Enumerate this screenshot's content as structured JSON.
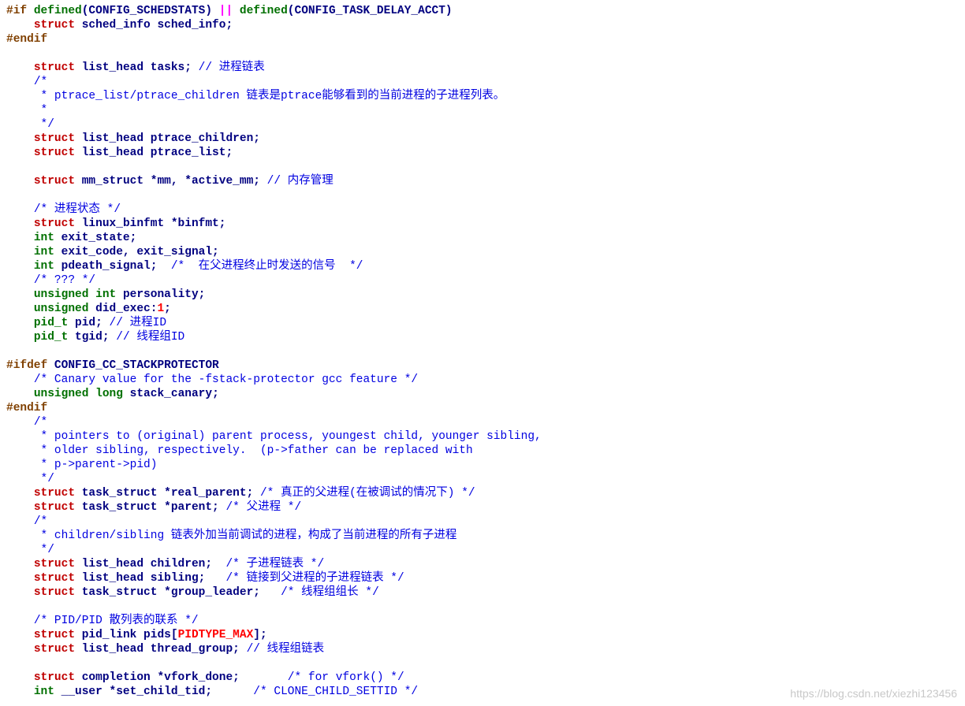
{
  "lines": [
    [
      [
        "pp",
        "#if"
      ],
      [
        "tx",
        " "
      ],
      [
        "ty",
        "defined"
      ],
      [
        "tx",
        "(CONFIG_SCHEDSTATS) "
      ],
      [
        "op",
        "||"
      ],
      [
        "tx",
        " "
      ],
      [
        "ty",
        "defined"
      ],
      [
        "tx",
        "(CONFIG_TASK_DELAY_ACCT)"
      ]
    ],
    [
      [
        "tx",
        "    "
      ],
      [
        "kw",
        "struct"
      ],
      [
        "tx",
        " sched_info sched_info;"
      ]
    ],
    [
      [
        "pp",
        "#endif"
      ]
    ],
    [],
    [
      [
        "tx",
        "    "
      ],
      [
        "kw",
        "struct"
      ],
      [
        "tx",
        " list_head tasks; "
      ],
      [
        "cm",
        "// 进程链表"
      ]
    ],
    [
      [
        "tx",
        "    "
      ],
      [
        "cm",
        "/*"
      ]
    ],
    [
      [
        "tx",
        "     "
      ],
      [
        "cm",
        "* ptrace_list/ptrace_children 链表是ptrace能够看到的当前进程的子进程列表。"
      ]
    ],
    [
      [
        "tx",
        "     "
      ],
      [
        "cm",
        "*"
      ]
    ],
    [
      [
        "tx",
        "     "
      ],
      [
        "cm",
        "*/"
      ]
    ],
    [
      [
        "tx",
        "    "
      ],
      [
        "kw",
        "struct"
      ],
      [
        "tx",
        " list_head ptrace_children;"
      ]
    ],
    [
      [
        "tx",
        "    "
      ],
      [
        "kw",
        "struct"
      ],
      [
        "tx",
        " list_head ptrace_list;"
      ]
    ],
    [],
    [
      [
        "tx",
        "    "
      ],
      [
        "kw",
        "struct"
      ],
      [
        "tx",
        " mm_struct *mm, *active_mm; "
      ],
      [
        "cm",
        "// 内存管理"
      ]
    ],
    [],
    [
      [
        "tx",
        "    "
      ],
      [
        "cm",
        "/* 进程状态 */"
      ]
    ],
    [
      [
        "tx",
        "    "
      ],
      [
        "kw",
        "struct"
      ],
      [
        "tx",
        " linux_binfmt *binfmt;"
      ]
    ],
    [
      [
        "tx",
        "    "
      ],
      [
        "ty",
        "int"
      ],
      [
        "tx",
        " exit_state;"
      ]
    ],
    [
      [
        "tx",
        "    "
      ],
      [
        "ty",
        "int"
      ],
      [
        "tx",
        " exit_code, exit_signal;"
      ]
    ],
    [
      [
        "tx",
        "    "
      ],
      [
        "ty",
        "int"
      ],
      [
        "tx",
        " pdeath_signal;  "
      ],
      [
        "cm",
        "/*  在父进程终止时发送的信号  */"
      ]
    ],
    [
      [
        "tx",
        "    "
      ],
      [
        "cm",
        "/* ??? */"
      ]
    ],
    [
      [
        "tx",
        "    "
      ],
      [
        "ty",
        "unsigned"
      ],
      [
        "tx",
        " "
      ],
      [
        "ty",
        "int"
      ],
      [
        "tx",
        " personality;"
      ]
    ],
    [
      [
        "tx",
        "    "
      ],
      [
        "ty",
        "unsigned"
      ],
      [
        "tx",
        " did_exec:"
      ],
      [
        "num",
        "1"
      ],
      [
        "tx",
        ";"
      ]
    ],
    [
      [
        "tx",
        "    "
      ],
      [
        "ty",
        "pid_t"
      ],
      [
        "tx",
        " pid; "
      ],
      [
        "cm",
        "// 进程ID"
      ]
    ],
    [
      [
        "tx",
        "    "
      ],
      [
        "ty",
        "pid_t"
      ],
      [
        "tx",
        " tgid; "
      ],
      [
        "cm",
        "// 线程组ID"
      ]
    ],
    [],
    [
      [
        "pp",
        "#ifdef"
      ],
      [
        "tx",
        " CONFIG_CC_STACKPROTECTOR"
      ]
    ],
    [
      [
        "tx",
        "    "
      ],
      [
        "cm",
        "/* Canary value for the -fstack-protector gcc feature */"
      ]
    ],
    [
      [
        "tx",
        "    "
      ],
      [
        "ty",
        "unsigned"
      ],
      [
        "tx",
        " "
      ],
      [
        "ty",
        "long"
      ],
      [
        "tx",
        " stack_canary;"
      ]
    ],
    [
      [
        "pp",
        "#endif"
      ]
    ],
    [
      [
        "tx",
        "    "
      ],
      [
        "cm",
        "/*"
      ]
    ],
    [
      [
        "tx",
        "     "
      ],
      [
        "cm",
        "* pointers to (original) parent process, youngest child, younger sibling,"
      ]
    ],
    [
      [
        "tx",
        "     "
      ],
      [
        "cm",
        "* older sibling, respectively.  (p->father can be replaced with"
      ]
    ],
    [
      [
        "tx",
        "     "
      ],
      [
        "cm",
        "* p->parent->pid)"
      ]
    ],
    [
      [
        "tx",
        "     "
      ],
      [
        "cm",
        "*/"
      ]
    ],
    [
      [
        "tx",
        "    "
      ],
      [
        "kw",
        "struct"
      ],
      [
        "tx",
        " task_struct *real_parent; "
      ],
      [
        "cm",
        "/* 真正的父进程(在被调试的情况下) */"
      ]
    ],
    [
      [
        "tx",
        "    "
      ],
      [
        "kw",
        "struct"
      ],
      [
        "tx",
        " task_struct *parent; "
      ],
      [
        "cm",
        "/* 父进程 */"
      ]
    ],
    [
      [
        "tx",
        "    "
      ],
      [
        "cm",
        "/*"
      ]
    ],
    [
      [
        "tx",
        "     "
      ],
      [
        "cm",
        "* children/sibling 链表外加当前调试的进程，构成了当前进程的所有子进程"
      ]
    ],
    [
      [
        "tx",
        "     "
      ],
      [
        "cm",
        "*/"
      ]
    ],
    [
      [
        "tx",
        "    "
      ],
      [
        "kw",
        "struct"
      ],
      [
        "tx",
        " list_head children;  "
      ],
      [
        "cm",
        "/* 子进程链表 */"
      ]
    ],
    [
      [
        "tx",
        "    "
      ],
      [
        "kw",
        "struct"
      ],
      [
        "tx",
        " list_head sibling;   "
      ],
      [
        "cm",
        "/* 链接到父进程的子进程链表 */"
      ]
    ],
    [
      [
        "tx",
        "    "
      ],
      [
        "kw",
        "struct"
      ],
      [
        "tx",
        " task_struct *group_leader;   "
      ],
      [
        "cm",
        "/* 线程组组长 */"
      ]
    ],
    [],
    [
      [
        "tx",
        "    "
      ],
      [
        "cm",
        "/* PID/PID 散列表的联系 */"
      ]
    ],
    [
      [
        "tx",
        "    "
      ],
      [
        "kw",
        "struct"
      ],
      [
        "tx",
        " pid_link pids["
      ],
      [
        "num",
        "PIDTYPE_MAX"
      ],
      [
        "tx",
        "];"
      ]
    ],
    [
      [
        "tx",
        "    "
      ],
      [
        "kw",
        "struct"
      ],
      [
        "tx",
        " list_head thread_group; "
      ],
      [
        "cm",
        "// 线程组链表"
      ]
    ],
    [],
    [
      [
        "tx",
        "    "
      ],
      [
        "kw",
        "struct"
      ],
      [
        "tx",
        " completion *vfork_done;       "
      ],
      [
        "cm",
        "/* for vfork() */"
      ]
    ],
    [
      [
        "tx",
        "    "
      ],
      [
        "ty",
        "int"
      ],
      [
        "tx",
        " __user *set_child_tid;      "
      ],
      [
        "cm",
        "/* CLONE_CHILD_SETTID */"
      ]
    ]
  ],
  "watermark": "https://blog.csdn.net/xiezhi123456"
}
